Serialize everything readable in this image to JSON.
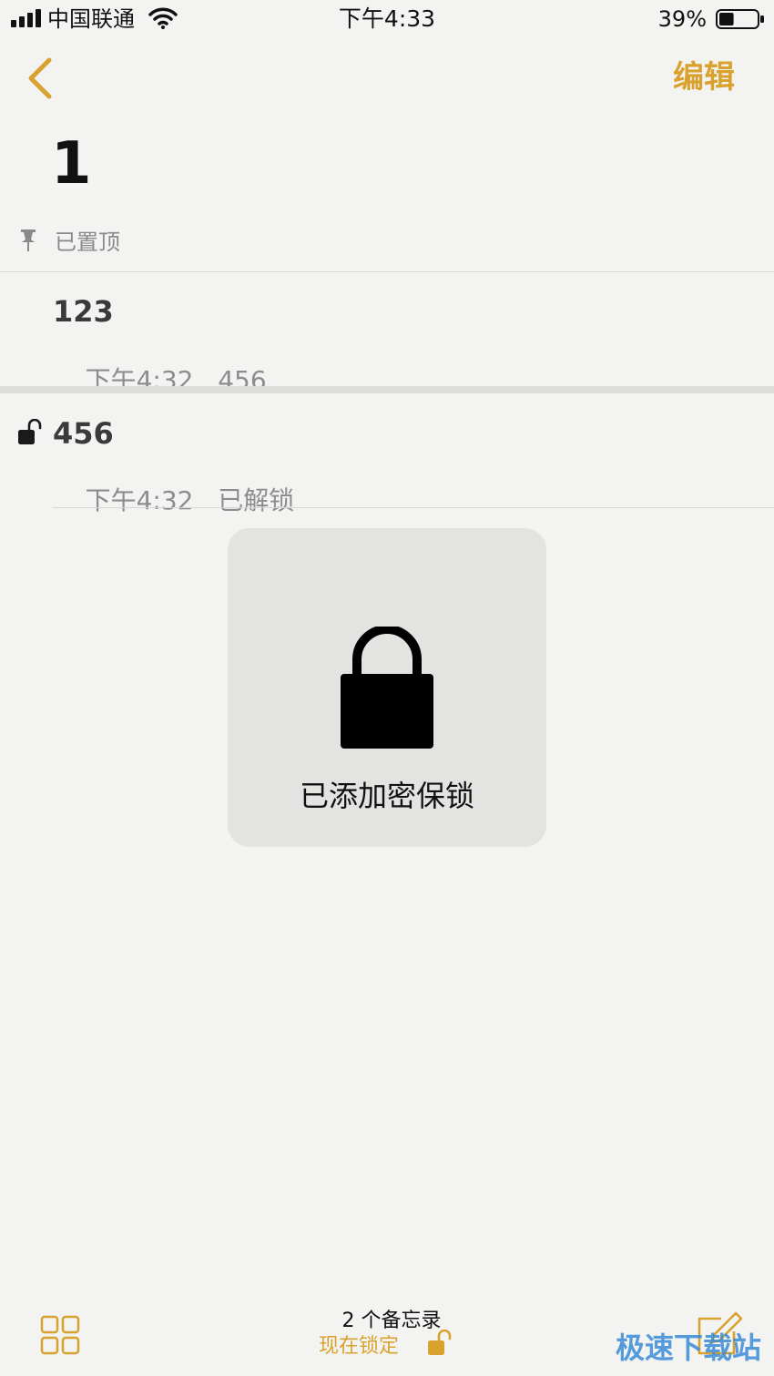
{
  "status_bar": {
    "carrier": "中国联通",
    "time": "下午4:33",
    "battery_percent": "39%",
    "battery_level": 0.39
  },
  "nav": {
    "back_icon": "chevron-left-icon",
    "edit_label": "编辑"
  },
  "folder": {
    "title": "1"
  },
  "pinned": {
    "label": "已置顶",
    "icon": "pin-icon"
  },
  "notes": [
    {
      "title": "123",
      "time": "下午4:32",
      "preview": "456",
      "locked": false
    },
    {
      "title": "456",
      "time": "下午4:32",
      "preview": "已解锁",
      "locked": true,
      "lock_icon": "unlocked-padlock-icon"
    }
  ],
  "lock_hud": {
    "icon": "padlock-icon",
    "label": "已添加密保锁"
  },
  "toolbar": {
    "folders_icon": "grid-icon",
    "note_count": "2 个备忘录",
    "lock_now_label": "现在锁定",
    "lock_now_icon": "unlocked-padlock-icon",
    "compose_icon": "compose-icon"
  },
  "watermark": {
    "text": "极速下载站"
  },
  "colors": {
    "accent": "#d9a22f",
    "background": "#f3f3f1",
    "hud_background": "#e3e3e1",
    "watermark": "#3a8bd6"
  }
}
